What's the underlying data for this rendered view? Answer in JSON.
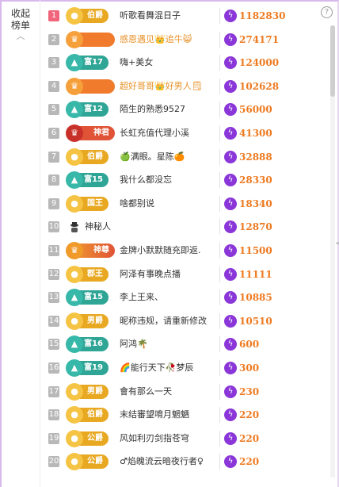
{
  "sidebar": {
    "collapse_label": "收起",
    "collapse_label2": "榜单",
    "chevron_icon": "chevron-up-icon"
  },
  "help_icon": "?",
  "right_edge": "<",
  "colors": {
    "gold_badge": "#e8a822",
    "teal_badge": "#2fa596",
    "orange_badge": "#f07b2c",
    "red_badge": "#e05336",
    "score": "#ee7a20",
    "bolt": "#8a36d8",
    "rank_first": "#f0657c",
    "rank_other": "#b8b8b8"
  },
  "rows": [
    {
      "rank": "1",
      "badge": "伯爵",
      "badge_style": "gold",
      "name": "听歌看舞混日子",
      "score": "1182830"
    },
    {
      "rank": "2",
      "badge": "",
      "badge_style": "orange_wide",
      "name": "感恩遇见👑追牛😸",
      "score": "274171"
    },
    {
      "rank": "3",
      "badge": "富17",
      "badge_style": "teal",
      "name": "嗨+美女",
      "score": "124000"
    },
    {
      "rank": "4",
      "badge": "",
      "badge_style": "orange_wide",
      "name": "超好哥哥👑好男人🗒",
      "score": "102628"
    },
    {
      "rank": "5",
      "badge": "富12",
      "badge_style": "teal",
      "name": "陌生的熟悉9527",
      "score": "56000"
    },
    {
      "rank": "6",
      "badge": "神君",
      "badge_style": "red",
      "name": "长虹充值代理小溪",
      "score": "41300"
    },
    {
      "rank": "7",
      "badge": "伯爵",
      "badge_style": "gold",
      "name": "🍏满眼。星陈🍊",
      "score": "32888"
    },
    {
      "rank": "8",
      "badge": "富15",
      "badge_style": "teal",
      "name": "我什么都没忘",
      "score": "28330"
    },
    {
      "rank": "9",
      "badge": "国王",
      "badge_style": "gold",
      "name": "啥都别说",
      "score": "18340"
    },
    {
      "rank": "10",
      "badge": "",
      "badge_style": "anon",
      "name": "神秘人",
      "score": "12870"
    },
    {
      "rank": "11",
      "badge": "神尊",
      "badge_style": "orange_red",
      "name": "金牌小默默随充即返.",
      "score": "11500"
    },
    {
      "rank": "12",
      "badge": "郡王",
      "badge_style": "gold",
      "name": "阿泽有事晚点播",
      "score": "11111"
    },
    {
      "rank": "13",
      "badge": "富15",
      "badge_style": "teal",
      "name": "李上王来、",
      "score": "10885"
    },
    {
      "rank": "14",
      "badge": "男爵",
      "badge_style": "gold",
      "name": "昵称违规，请重新修改",
      "score": "10510"
    },
    {
      "rank": "15",
      "badge": "富16",
      "badge_style": "teal",
      "name": "阿鸿🌴",
      "score": "600"
    },
    {
      "rank": "16",
      "badge": "富19",
      "badge_style": "teal",
      "name": "🌈能行天下🥀梦辰",
      "score": "300"
    },
    {
      "rank": "17",
      "badge": "男爵",
      "badge_style": "gold",
      "name": "會有那么一天",
      "score": "230"
    },
    {
      "rank": "18",
      "badge": "伯爵",
      "badge_style": "gold",
      "name": "末结審望唷月魍魉",
      "score": "220"
    },
    {
      "rank": "19",
      "badge": "公爵",
      "badge_style": "gold",
      "name": "风如利刃剑指苍穹",
      "score": "220"
    },
    {
      "rank": "20",
      "badge": "公爵",
      "badge_style": "gold",
      "name": "♂焰魄流云暗夜行者♀",
      "score": "220"
    }
  ]
}
